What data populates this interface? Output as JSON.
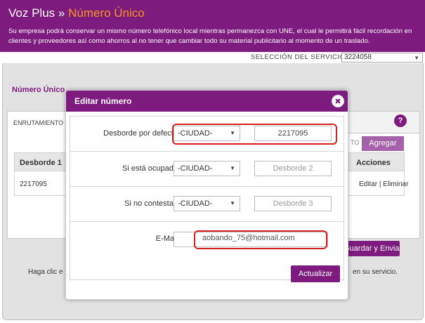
{
  "header": {
    "brand": "Voz Plus",
    "separator": "»",
    "section": "Número Único",
    "description": "Su empresa podrá conservar un mismo número telefónico local mientras permanezca con UNE, el cual le permitirá fácil recordación en clientes y proveedores así como ahorros al no tener que cambiar todo su material publicitario al momento de un traslado."
  },
  "service": {
    "label": "SELECCIÓN DEL SERVICIO:",
    "selected": "3224058"
  },
  "background": {
    "breadcrumb": "Número Único",
    "tab": "ENRUTAMIENTO",
    "help": "?",
    "ghost_text": "TO",
    "add_button": "Agregar",
    "table": {
      "headers": [
        "Desborde 1",
        "Acciones"
      ],
      "row": {
        "value": "2217095",
        "edit": "Editar",
        "sep": " | ",
        "delete": "Eliminar"
      }
    },
    "save_button": "Guardar y Enviar",
    "hint_left": "Haga clic e",
    "hint_right": "en su servicio."
  },
  "modal": {
    "title": "Editar número",
    "close": "✖",
    "rows": [
      {
        "label": "Desborde por defecto:",
        "city": "-CIUDAD-",
        "phone": "2217095",
        "placeholder": false
      },
      {
        "label": "Si está ocupado:",
        "city": "-CIUDAD-",
        "phone": "Desborde 2",
        "placeholder": true
      },
      {
        "label": "Si no contestan:",
        "city": "-CIUDAD-",
        "phone": "Desborde 3",
        "placeholder": true
      }
    ],
    "email_label": "E-Mail:",
    "email_value": "aobando_75@hotmail.com",
    "update_button": "Actualizar",
    "highlight_color": "#d62020"
  },
  "colors": {
    "brand": "#7d1b7e",
    "accent": "#f7941d"
  }
}
